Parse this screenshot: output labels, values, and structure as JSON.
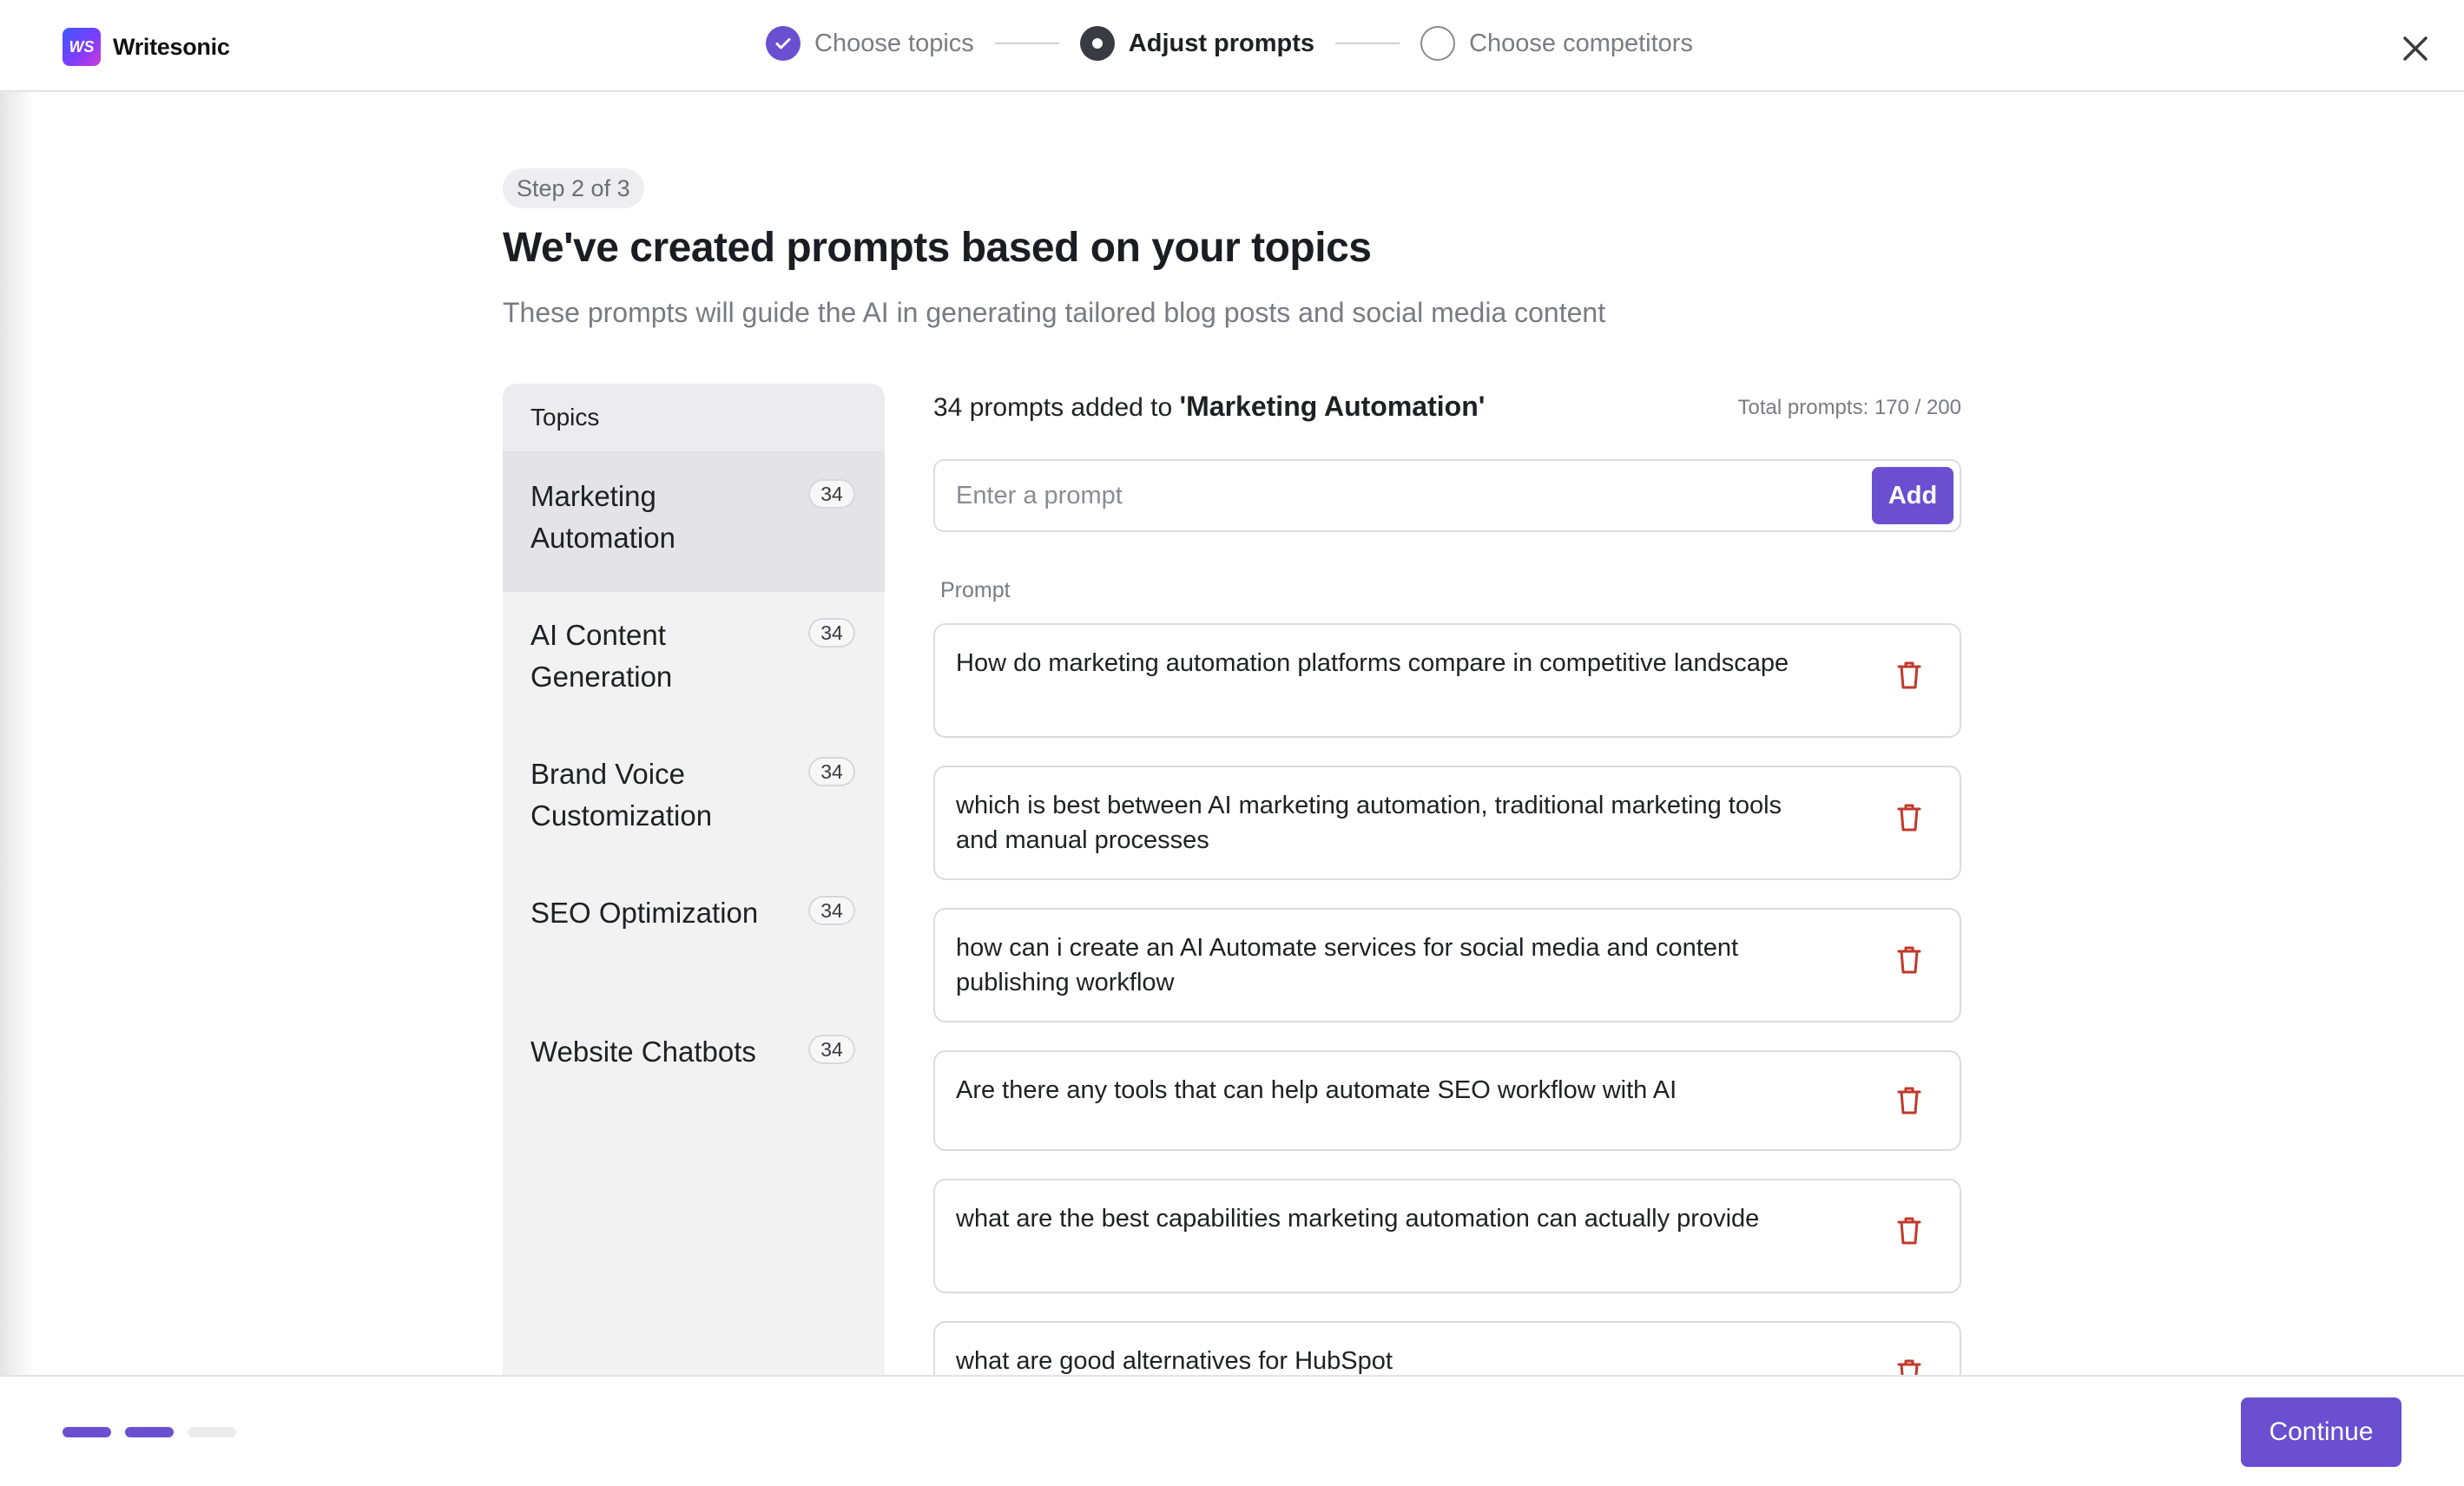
{
  "app": {
    "name": "Writesonic",
    "logo_mark": "WS"
  },
  "stepper": {
    "steps": [
      {
        "label": "Choose topics",
        "state": "done"
      },
      {
        "label": "Adjust prompts",
        "state": "active"
      },
      {
        "label": "Choose competitors",
        "state": "pending"
      }
    ]
  },
  "page": {
    "badge": "Step 2 of 3",
    "title": "We've created prompts based on your topics",
    "subtitle": "These prompts will guide the AI in generating tailored blog posts and social media content"
  },
  "sidebar": {
    "header": "Topics",
    "items": [
      {
        "label": "Marketing Automation",
        "count": "34"
      },
      {
        "label": "AI Content Generation",
        "count": "34"
      },
      {
        "label": "Brand Voice Customization",
        "count": "34"
      },
      {
        "label": "SEO Optimization",
        "count": "34"
      },
      {
        "label": "Website Chatbots",
        "count": "34"
      }
    ]
  },
  "main": {
    "count_prefix": "34 prompts added to ",
    "topic_ref": "'Marketing Automation'",
    "total": "Total prompts: 170 / 200",
    "input_placeholder": "Enter a prompt",
    "add_label": "Add",
    "column_label": "Prompt",
    "prompts": [
      "How do marketing automation platforms compare in competitive landscape",
      "which is best between AI marketing automation, traditional marketing tools and manual processes",
      "how can i create an AI Automate services for social media and content publishing workflow",
      "Are there any tools that can help automate SEO workflow with AI",
      "what are the best capabilities marketing automation can actually provide",
      "what are good alternatives for HubSpot"
    ]
  },
  "footer": {
    "continue_label": "Continue",
    "progress_steps_completed": 2,
    "progress_steps_total": 3
  },
  "colors": {
    "accent": "#6a4fd1",
    "trash": "#c0392b"
  }
}
